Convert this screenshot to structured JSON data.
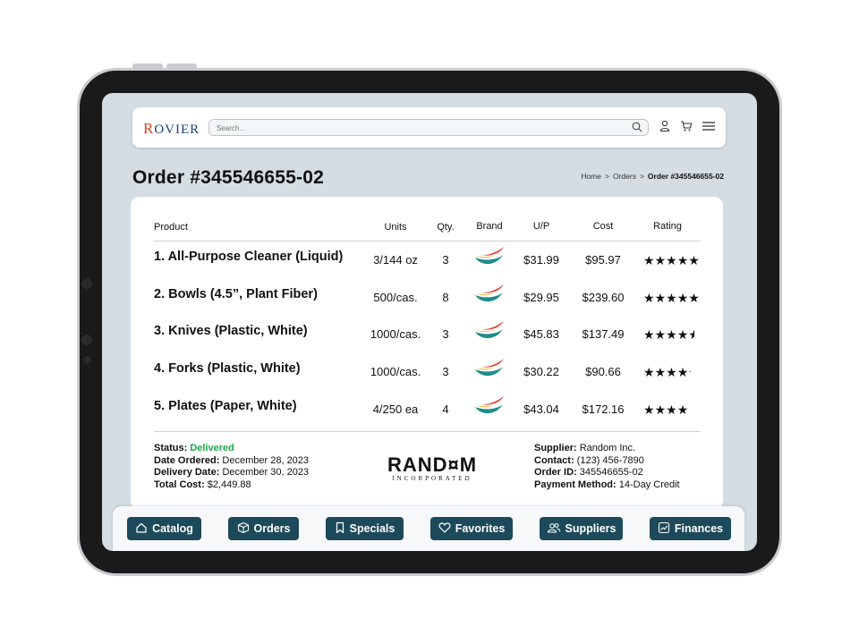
{
  "header": {
    "logo": "ROVIER",
    "search_placeholder": "Search..."
  },
  "page": {
    "title": "Order #345546655-02",
    "breadcrumb": [
      "Home",
      "Orders",
      "Order #345546655-02"
    ],
    "breadcrumb_sep": ">"
  },
  "table": {
    "columns": [
      "Product",
      "Units",
      "Qty.",
      "Brand",
      "U/P",
      "Cost",
      "Rating"
    ],
    "rows": [
      {
        "product": "1. All-Purpose Cleaner (Liquid)",
        "units": "3/144 oz",
        "qty": "3",
        "unit_price": "$31.99",
        "cost": "$95.97",
        "rating": 5
      },
      {
        "product": "2. Bowls (4.5”, Plant Fiber)",
        "units": "500/cas.",
        "qty": "8",
        "unit_price": "$29.95",
        "cost": "$239.60",
        "rating": 5
      },
      {
        "product": "3. Knives (Plastic, White)",
        "units": "1000/cas.",
        "qty": "3",
        "unit_price": "$45.83",
        "cost": "$137.49",
        "rating": 4.5
      },
      {
        "product": "4. Forks (Plastic, White)",
        "units": "1000/cas.",
        "qty": "3",
        "unit_price": "$30.22",
        "cost": "$90.66",
        "rating": 4.2
      },
      {
        "product": "5. Plates (Paper, White)",
        "units": "4/250 ea",
        "qty": "4",
        "unit_price": "$43.04",
        "cost": "$172.16",
        "rating": 4
      }
    ]
  },
  "order_info": {
    "status_label": "Status:",
    "status": "Delivered",
    "date_ordered_label": "Date Ordered:",
    "date_ordered": "December 28, 2023",
    "delivery_date_label": "Delivery Date:",
    "delivery_date": "December 30, 2023",
    "total_cost_label": "Total Cost:",
    "total_cost": "$2,449.88"
  },
  "supplier_logo": {
    "main": "RAND¤M",
    "sub": "INCORPORATED"
  },
  "supplier_info": {
    "supplier_label": "Supplier:",
    "supplier": "Random Inc.",
    "contact_label": "Contact:",
    "contact": "(123) 456-7890",
    "order_id_label": "Order ID:",
    "order_id": "345546655-02",
    "payment_label": "Payment Method:",
    "payment": "14-Day Credit"
  },
  "nav": [
    {
      "label": "Catalog",
      "icon": "home-icon"
    },
    {
      "label": "Orders",
      "icon": "box-icon"
    },
    {
      "label": "Specials",
      "icon": "bookmark-icon"
    },
    {
      "label": "Favorites",
      "icon": "heart-icon"
    },
    {
      "label": "Suppliers",
      "icon": "users-icon"
    },
    {
      "label": "Finances",
      "icon": "chart-icon"
    }
  ],
  "colors": {
    "accent": "#1d4a5a",
    "status_ok": "#1ea84a",
    "screen_bg": "#d4dde2"
  }
}
